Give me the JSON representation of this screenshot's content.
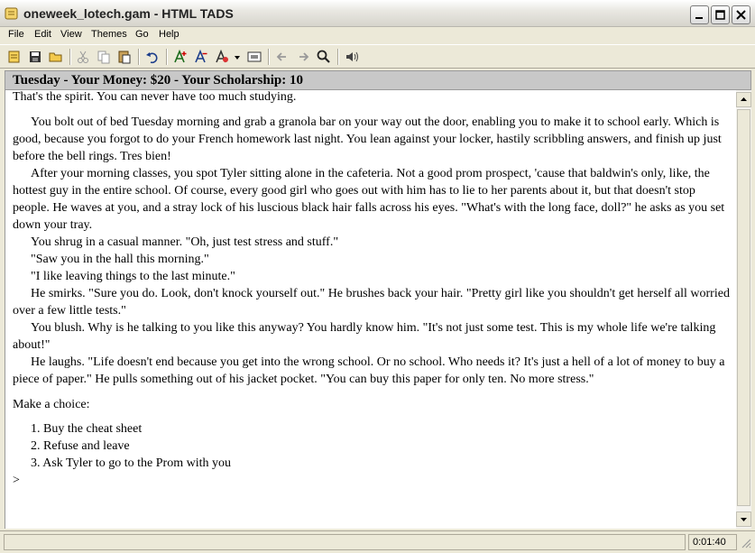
{
  "window": {
    "title": "oneweek_lotech.gam - HTML TADS"
  },
  "menu": [
    "File",
    "Edit",
    "View",
    "Themes",
    "Go",
    "Help"
  ],
  "toolbar": {
    "icons": [
      "new-game-icon",
      "save-icon",
      "open-icon",
      "cut-icon",
      "copy-icon",
      "paste-icon",
      "undo-icon",
      "font-larger-icon",
      "font-smaller-icon",
      "font-options-icon",
      "dropdown-arrow-icon",
      "options-icon",
      "back-icon",
      "forward-icon",
      "find-icon",
      "sound-icon"
    ]
  },
  "status": {
    "line": "Tuesday - Your Money:  $20 - Your Scholarship:  10"
  },
  "story": {
    "top_cut": "That's the spirit.  You can never have too much studying.",
    "p1": "You bolt out of bed Tuesday morning and grab a granola bar on your way out the door, enabling you to make it to school early.  Which is good, because you forgot to do your French homework last night.  You lean against your locker, hastily scribbling answers, and finish up just before the bell rings.  Tres bien!",
    "p2": "After your morning classes, you spot Tyler sitting alone in the cafeteria.  Not a good prom prospect, 'cause that baldwin's only, like, the hottest guy in the entire school.  Of course, every good girl who goes out with him has to lie to her parents about it, but that doesn't stop people.  He waves at you, and a stray lock of his luscious black hair falls across his eyes.  \"What's with the long face, doll?\"  he asks as you set down your tray.",
    "p3": "You shrug in a casual manner.  \"Oh, just test stress and stuff.\"",
    "p4": "\"Saw you in the hall this morning.\"",
    "p5": "\"I like leaving things to the last minute.\"",
    "p6": "He smirks.  \"Sure you do.  Look, don't knock yourself out.\"  He brushes back your hair.  \"Pretty girl like you shouldn't get herself all worried over a few little tests.\"",
    "p7": "You blush.  Why is he talking to you like this anyway?  You hardly know him.  \"It's not just some test.  This is my whole life we're talking about!\"",
    "p8": "He laughs.  \"Life doesn't end because you get into the wrong school.  Or no school.  Who needs it?  It's just a hell of a lot of money to buy a piece of paper.\"  He pulls something out of his jacket pocket.  \"You can buy this paper for only ten.  No more stress.\"",
    "choice_heading": "Make a choice:",
    "choices": [
      "1.  Buy the cheat sheet",
      "2.  Refuse and leave",
      "3.  Ask Tyler to go to the Prom with you"
    ],
    "prompt": ">"
  },
  "statusbar": {
    "elapsed": "0:01:40"
  }
}
